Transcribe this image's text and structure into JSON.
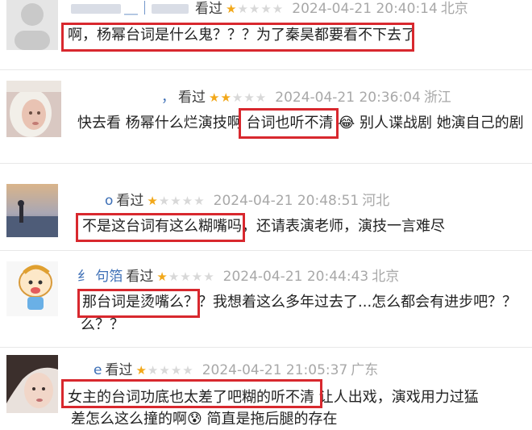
{
  "comments": [
    {
      "username": "＿｜",
      "label": "看过",
      "rating": 1,
      "time": "2024-04-21 20:40:14",
      "location": "北京",
      "text": "啊，杨幂台词是什么鬼？？？为了秦昊都要看不下去了"
    },
    {
      "username": "，",
      "label": "看过",
      "rating": 2,
      "time": "2024-04-21 20:36:04",
      "location": "浙江",
      "text_before": "快去看 杨幂什么烂演技啊 ",
      "text_highlight": "台词也听不清",
      "text_emoji": "😂",
      "text_after": " 别人谍战剧 她演自己的剧"
    },
    {
      "username": "o",
      "label": "看过",
      "rating": 1,
      "time": "2024-04-21 20:48:51",
      "location": "河北",
      "text_highlight": "不是这台词有这么糊嘴吗",
      "text_after": "，还请表演老师，演技一言难尽"
    },
    {
      "username": "纟                  句箔",
      "label": "看过",
      "rating": 1,
      "time": "2024-04-21 20:44:43",
      "location": "北京",
      "text_highlight": "那台词是烫嘴么？",
      "text_after": "？我想着这么多年过去了...怎么都会有进步吧？？",
      "text_line2": "么？？"
    },
    {
      "username": "e",
      "label": "看过",
      "rating": 1,
      "time": "2024-04-21 21:05:37",
      "location": "广东",
      "text_highlight": "女主的台词功底也太差了吧糊的听不清",
      "text_after": "  让人出戏，演戏用力过猛",
      "text_line2": "差怎么这么撞的啊😰  简直是拖后腿的存在"
    }
  ],
  "colors": {
    "highlight": "#d8282e",
    "star_on": "#f2a81a",
    "star_off": "#d8d8d8",
    "username": "#3d6fb6"
  }
}
